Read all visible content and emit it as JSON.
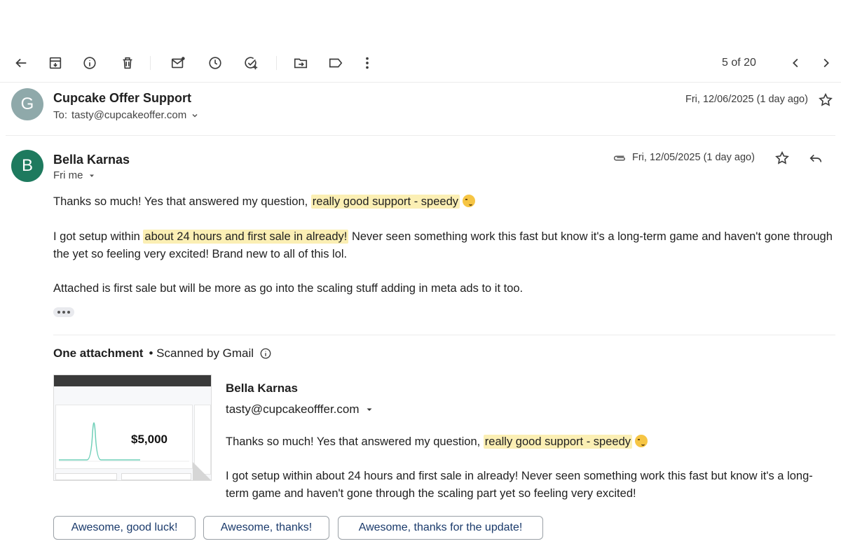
{
  "toolbar": {
    "icons": [
      "back-arrow-icon",
      "archive-icon",
      "info-icon",
      "trash-icon",
      "mark-unread-icon",
      "snooze-clock-icon",
      "add-task-icon",
      "move-to-folder-icon",
      "label-icon",
      "more-vert-icon",
      "chevron-left-icon",
      "chevron-right-icon"
    ],
    "pager": "5 of 20"
  },
  "thread_top": {
    "avatar_letter": "G",
    "avatar_color": "#8fa9aa",
    "sender": "Cupcake Offer Support",
    "to_label": "To:",
    "to_address": "tasty@cupcakeoffer.com",
    "date": "Fri, 12/06/2025 (1 day ago)"
  },
  "message": {
    "avatar_letter": "B",
    "avatar_color": "#1e7a5e",
    "sender": "Bella Karnas",
    "recipient": "Fri me",
    "date": "Fri, 12/05/2025 (1 day ago)",
    "p1_a": "Thanks so much! Yes that answered my question, ",
    "p1_hl": "really good support - speedy",
    "p2_a": "I got setup within ",
    "p2_hl": "about 24 hours and first sale in already!",
    "p2_b": " Never seen something work this fast but know it's a long-term game and haven't gone through the yet so feeling very excited! Brand new to all of this lol.",
    "p3": "Attached is first sale but will be more as go into the scaling stuff adding in meta ads to it too."
  },
  "attachment": {
    "heading": "One attachment",
    "scanned": "• Scanned by Gmail",
    "thumb_amount": "$5,000",
    "preview_name": "Bella Karnas",
    "preview_email": "tasty@cupcakeofffer.com",
    "pv1_a": "Thanks so much! Yes that answered my question, ",
    "pv1_hl": "really good support - speedy",
    "pv2": "I got setup within about 24 hours and first sale in already! Never seen something work this fast but know it's a long-term game and haven't gone through the scaling part yet so feeling very excited!"
  },
  "smart_replies": [
    "Awesome, good luck!",
    "Awesome, thanks!",
    "Awesome, thanks for the update!"
  ]
}
